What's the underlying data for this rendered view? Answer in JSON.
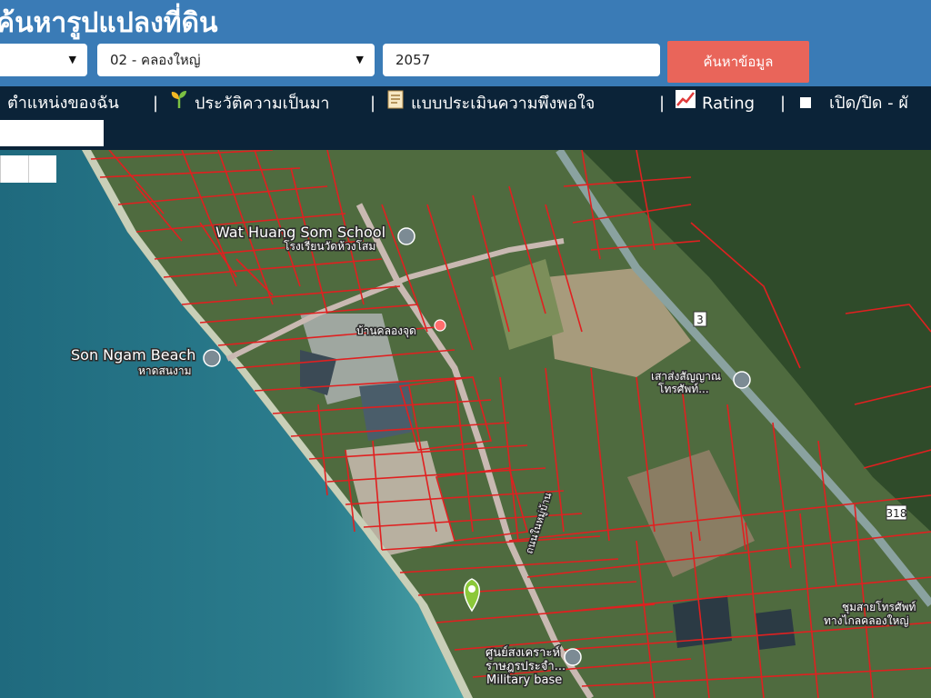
{
  "header": {
    "title": "ค้นหารูปแปลงที่ดิน",
    "district_select": {
      "value": "02 - คลองใหญ่"
    },
    "parcel_input": {
      "value": "2057"
    },
    "search_button": "ค้นหาข้อมูล"
  },
  "nav": {
    "items": [
      {
        "label": "ตำแหน่งของฉัน",
        "icon": "location-icon"
      },
      {
        "label": "ประวัติความเป็นมา",
        "icon": "sprout-icon"
      },
      {
        "label": "แบบประเมินความพึงพอใจ",
        "icon": "form-icon"
      },
      {
        "label": "Rating",
        "icon": "chart-icon"
      },
      {
        "label": "เปิด/ปิด - ผั",
        "icon": "checkbox-icon"
      }
    ],
    "separator": "|"
  },
  "map": {
    "labels": {
      "school_en": "Wat Huang Som School",
      "school_th": "โรงเรียนวัดห้วงโสม",
      "beach_en": "Son Ngam Beach",
      "beach_th": "หาดสนงาม",
      "village": "บ้านคลองจุด",
      "office": "เสาส่งสัญญาณ",
      "office2": "โทรศัพท์...",
      "road3": "3",
      "road318": "318",
      "center_th": "ศูนย์สงเคราะห์",
      "center_th2": "ราษฎรประจำ...",
      "military": "Military base",
      "phone_th": "ชุมสายโทรศัพท์",
      "phone_th2": "ทางไกลคลองใหญ่",
      "road_small": "ถนนในหมู่บ้าน"
    },
    "colors": {
      "sea": "#2f7f8c",
      "land": "#4c6a3b",
      "parcel_lines": "#e02020",
      "header": "#3a7bb6",
      "navbar": "#0b2338",
      "search_button": "#e9655a"
    }
  }
}
